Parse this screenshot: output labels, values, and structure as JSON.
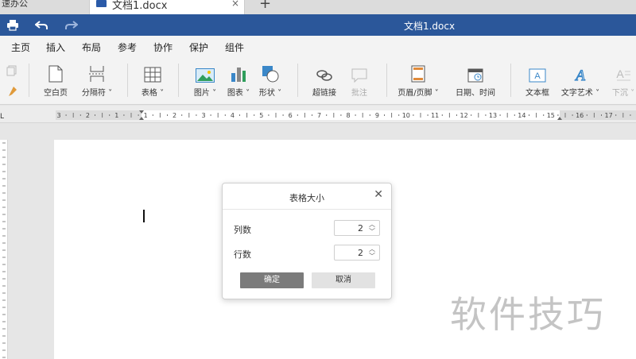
{
  "tabs": {
    "previous_tab": "速办公",
    "active_tab": "文档1.docx",
    "close_glyph": "×",
    "new_tab_glyph": "+"
  },
  "titlebar": {
    "document_name": "文档1.docx",
    "color": "#2b579a"
  },
  "ribbon_tabs": [
    "主页",
    "插入",
    "布局",
    "参考",
    "协作",
    "保护",
    "组件"
  ],
  "active_ribbon_tab": "插入",
  "toolbar": {
    "blank_page": "空白页",
    "section_break": "分隔符",
    "table": "表格",
    "picture": "图片",
    "chart": "图表",
    "shape": "形状",
    "hyperlink": "超链接",
    "comment": "批注",
    "header_footer": "页眉/页脚",
    "date_time": "日期、时间",
    "text_box": "文本框",
    "word_art": "文字艺术",
    "drop_cap": "下沉"
  },
  "ruler": {
    "corner_label": "L",
    "numbers": [
      "3",
      "2",
      "1",
      "1",
      "2",
      "3",
      "4",
      "5",
      "6",
      "7",
      "8",
      "9",
      "10",
      "11",
      "12",
      "13",
      "14",
      "15",
      "16",
      "17"
    ]
  },
  "dialog": {
    "title": "表格大小",
    "close_glyph": "✕",
    "columns_label": "列数",
    "columns_value": "2",
    "rows_label": "行数",
    "rows_value": "2",
    "ok_label": "确定",
    "cancel_label": "取消"
  },
  "watermark": "软件技巧"
}
